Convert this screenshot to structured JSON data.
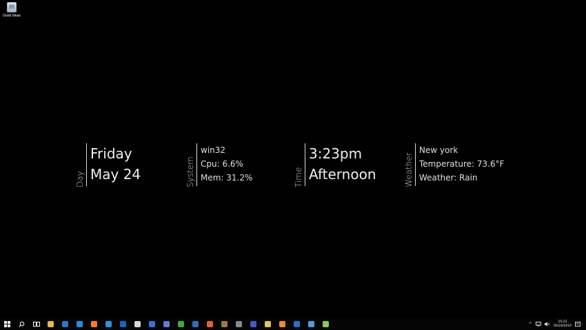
{
  "desktop": {
    "icon": {
      "label": "Good Ideas",
      "icon": "text-document-icon"
    }
  },
  "widgets": {
    "day": {
      "side_label": "Day",
      "line1": "Friday",
      "line2": "May 24"
    },
    "system": {
      "side_label": "System",
      "line1": "win32",
      "line2": "Cpu: 6.6%",
      "line3": "Mem: 31.2%"
    },
    "time": {
      "side_label": "Time",
      "line1": "3:23pm",
      "line2": "Afternoon"
    },
    "weather": {
      "side_label": "Weather",
      "line1": "New york",
      "line2": "Temperature: 73.6°F",
      "line3": "Weather: Rain"
    }
  },
  "taskbar": {
    "apps": [
      {
        "name": "start",
        "icon": "windows-logo-icon",
        "color": "#ffffff"
      },
      {
        "name": "search",
        "icon": "search-icon",
        "color": "#ffffff"
      },
      {
        "name": "task-view",
        "icon": "task-view-icon",
        "color": "#ffffff"
      },
      {
        "name": "file-explorer",
        "icon": "folder-icon",
        "color": "#e8b84a"
      },
      {
        "name": "steam",
        "icon": "steam-icon",
        "color": "#2a78c8"
      },
      {
        "name": "edge",
        "icon": "edge-icon",
        "color": "#1e8fe0"
      },
      {
        "name": "firefox",
        "icon": "firefox-icon",
        "color": "#ff7b21"
      },
      {
        "name": "vscode",
        "icon": "vscode-icon",
        "color": "#2c93dd"
      },
      {
        "name": "outlook",
        "icon": "outlook-icon",
        "color": "#0f6cbd"
      },
      {
        "name": "inkscape",
        "icon": "inkscape-icon",
        "color": "#d8d8d8"
      },
      {
        "name": "document-app",
        "icon": "document-icon",
        "color": "#3a6fd8"
      },
      {
        "name": "virtualbox",
        "icon": "window-app-icon",
        "color": "#5b7fd6"
      },
      {
        "name": "network-app",
        "icon": "network-icon",
        "color": "#3aa845"
      },
      {
        "name": "remote-desktop",
        "icon": "remote-icon",
        "color": "#2f6fb8"
      },
      {
        "name": "presentation-app",
        "icon": "presentation-icon",
        "color": "#e3632b"
      },
      {
        "name": "archive-app",
        "icon": "archive-icon",
        "color": "#a07a3a"
      },
      {
        "name": "terminal",
        "icon": "terminal-icon",
        "color": "#8a8a8a"
      },
      {
        "name": "powershell",
        "icon": "powershell-icon",
        "color": "#3b5fc8"
      },
      {
        "name": "chrome",
        "icon": "chrome-icon",
        "color": "#e8c547"
      },
      {
        "name": "blender",
        "icon": "blender-icon",
        "color": "#f08a24"
      },
      {
        "name": "outlook-2",
        "icon": "outlook-icon",
        "color": "#1a74c9"
      },
      {
        "name": "paint-app",
        "icon": "paint-icon",
        "color": "#4a9ee0"
      },
      {
        "name": "notepad-app",
        "icon": "notepad-icon",
        "color": "#8cc850"
      }
    ],
    "tray": {
      "chevron": "^",
      "volume_icon": "volume-icon",
      "time": "15:23",
      "date": "05/24/2019"
    }
  }
}
